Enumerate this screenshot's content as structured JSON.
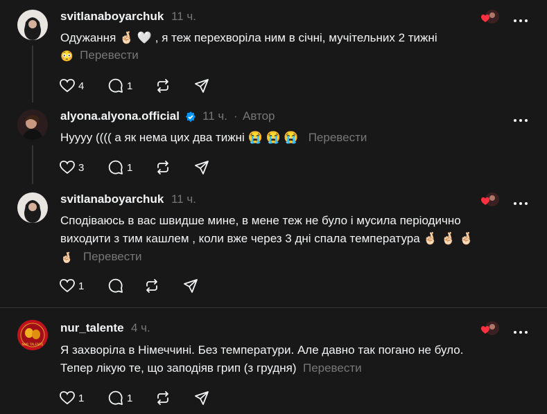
{
  "comments": [
    {
      "username": "svitlanaboyarchuk",
      "time": "11 ч.",
      "line1": "Одужання 🤞🏻 🤍 , я теж перехворіла ним в січні, мучітельних 2 тижні",
      "line2_emoji": "😳",
      "translate": "Перевести",
      "likes": "4",
      "replies": "1"
    },
    {
      "username": "alyona.alyona.official",
      "time": "11 ч.",
      "separator": "·",
      "author_badge": "Автор",
      "line1": "Нуууу (((( а як нема цих два тижні 😭 😭 😭",
      "translate": "Перевести",
      "likes": "3",
      "replies": "1"
    },
    {
      "username": "svitlanaboyarchuk",
      "time": "11 ч.",
      "line1": "Сподіваюсь в вас швидше мине, в мене теж не було і мусила періодично",
      "line2": "виходити з тим кашлем , коли вже через 3 дні спала температура 🤞🏻 🤞🏻 🤞🏻",
      "line3_emoji": "🤞🏻",
      "translate": "Перевести",
      "likes": "1",
      "replies": ""
    },
    {
      "username": "nur_talente",
      "time": "4 ч.",
      "line1": "Я захворіла в Німеччині. Без температури. Але давно так погано не було.",
      "line2": "Тепер лікую те, що заподіяв грип (з грудня)",
      "translate": "Перевести",
      "likes": "1",
      "replies": "1",
      "avatar_text": "NUR TALENTE"
    }
  ],
  "colors": {
    "background": "#181818",
    "text": "#f3f5f7",
    "muted": "#777777",
    "verified": "#0095f6",
    "heart": "#ff3040"
  }
}
